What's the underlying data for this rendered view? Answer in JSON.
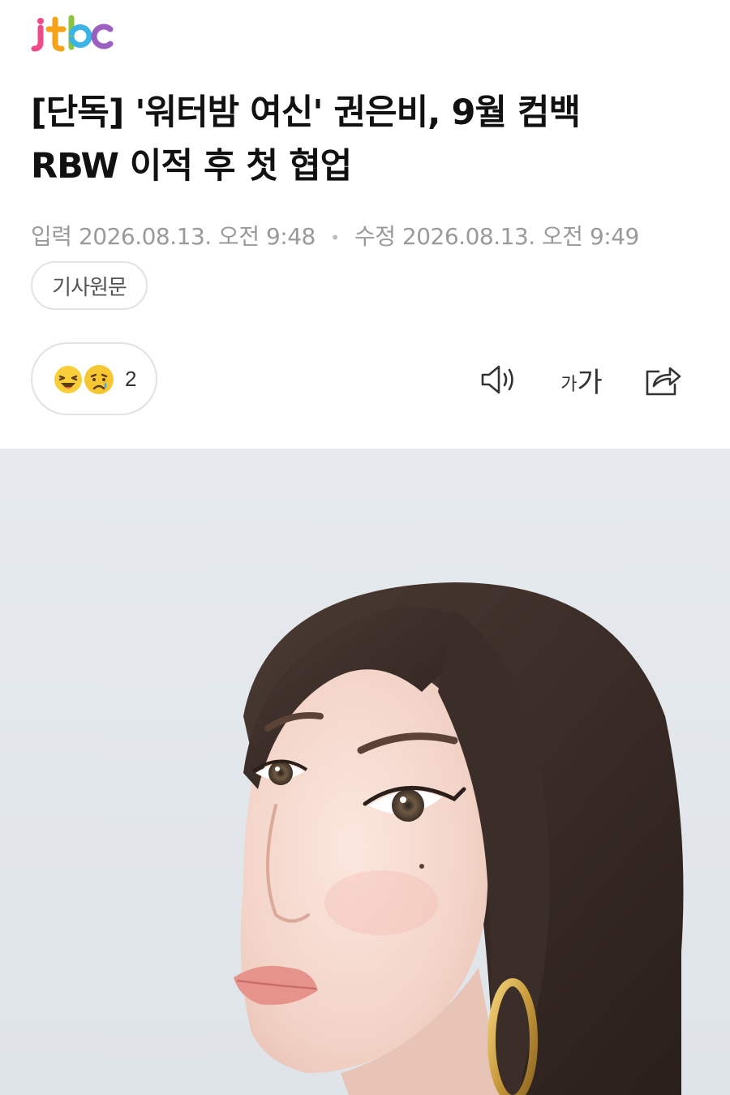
{
  "brand": {
    "name": "jtbc",
    "colors": [
      "#ef4a8b",
      "#f7a21b",
      "#8bc53f",
      "#3bb3e4",
      "#9b5fc0"
    ]
  },
  "article": {
    "headline_line1": "[단독] '워터밤 여신' 권은비, 9월 컴백",
    "headline_line2": "RBW 이적 후 첫 협업",
    "input_label": "입력",
    "input_time": "2026.08.13. 오전 9:48",
    "dot": "•",
    "modified_label": "수정",
    "modified_time": "2026.08.13. 오전 9:49",
    "original_button": "기사원문"
  },
  "reactions": {
    "icons": [
      "laughing-emoji",
      "crying-emoji"
    ],
    "count": "2"
  },
  "toolbar": {
    "font_small": "가",
    "font_big": "가",
    "icons": [
      "speaker-icon",
      "font-size-icon",
      "share-icon"
    ]
  },
  "photo": {
    "description_icon": "portrait-photo",
    "background": "#e8ebee"
  }
}
